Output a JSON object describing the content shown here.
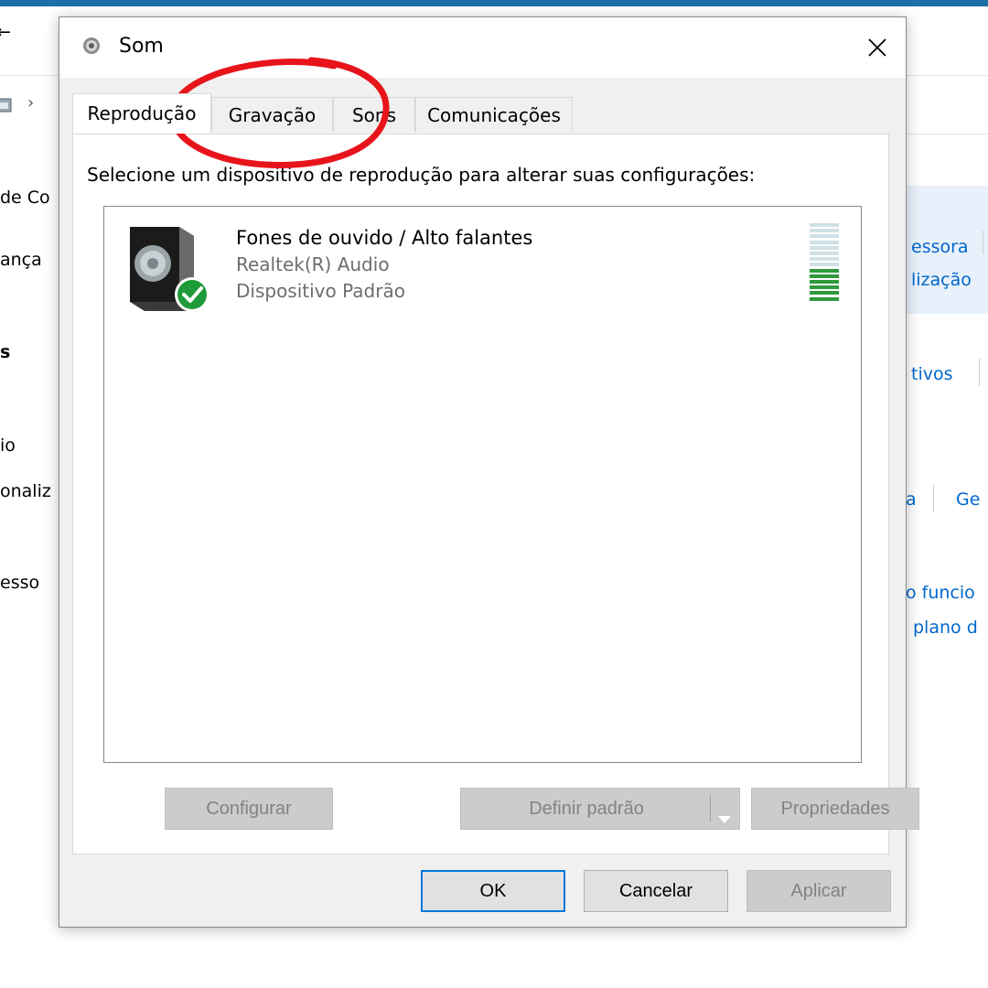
{
  "background": {
    "left_items": [
      "de Co",
      "ança",
      "s",
      "io",
      "onaliz",
      "esso"
    ],
    "right_items": [
      "essora",
      "lização",
      "tivos",
      "a",
      "Ge",
      "o funcio",
      "plano d"
    ],
    "colors": {
      "titlebar": "#1e6fa6",
      "link": "#0066cc"
    }
  },
  "dialog": {
    "title": "Som",
    "close_label": "✕",
    "tabs": [
      {
        "label": "Reprodução",
        "active": true
      },
      {
        "label": "Gravação",
        "active": false
      },
      {
        "label": "Sons",
        "active": false
      },
      {
        "label": "Comunicações",
        "active": false
      }
    ],
    "instruction": "Selecione um dispositivo de reprodução para alterar suas configurações:",
    "device": {
      "name": "Fones de ouvido / Alto falantes",
      "driver": "Realtek(R) Audio",
      "status": "Dispositivo Padrão",
      "icon": "speaker-icon",
      "badge_icon": "default-check-icon",
      "level_bars_total": 14,
      "level_bars_active": 6
    },
    "buttons": {
      "configure": "Configurar",
      "set_default": "Definir padrão",
      "properties": "Propriedades",
      "ok": "OK",
      "cancel": "Cancelar",
      "apply": "Aplicar"
    }
  },
  "annotation": {
    "shape": "ellipse",
    "color": "#e8141b",
    "target": "Gravação / Sons tabs"
  }
}
